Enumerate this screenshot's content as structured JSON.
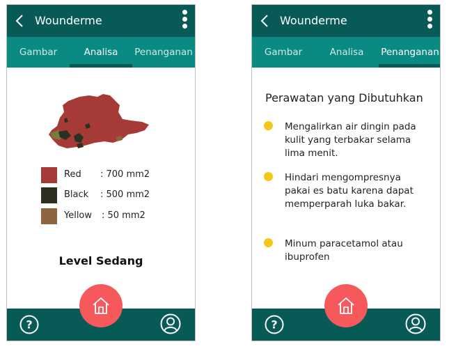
{
  "app": {
    "title": "Wounderme"
  },
  "colors": {
    "appbar": "#075a56",
    "tabbar": "#0a8a82",
    "home_button": "#f5595b",
    "bullet": "#f5c518",
    "wound_red": "#a63a37",
    "wound_black": "#2b3023",
    "wound_yellow": "#8f6540"
  },
  "screens": [
    {
      "tabs": [
        "Gambar",
        "Analisa",
        "Penanganan"
      ],
      "active_tab": "Analisa",
      "legend": [
        {
          "label": "Red",
          "value": ": 700 mm2",
          "color": "#a63a37"
        },
        {
          "label": "Black",
          "value": ": 500 mm2",
          "color": "#2b3023"
        },
        {
          "label": "Yellow",
          "value": ": 50 mm2",
          "color": "#8f6540"
        }
      ],
      "level": "Level Sedang"
    },
    {
      "tabs": [
        "Gambar",
        "Analisa",
        "Penanganan"
      ],
      "active_tab": "Penanganan",
      "care_title": "Perawatan yang Dibutuhkan",
      "care_items": [
        "Mengalirkan air dingin pada kulit yang terbakar selama lima menit.",
        "Hindari mengompresnya pakai es batu karena dapat memperparah luka bakar.",
        "Minum paracetamol atau ibuprofen"
      ]
    }
  ],
  "icons": {
    "back": "chevron-left-icon",
    "menu": "more-vert-icon",
    "help": "help-circle-icon",
    "home": "home-icon",
    "profile": "user-circle-icon"
  }
}
